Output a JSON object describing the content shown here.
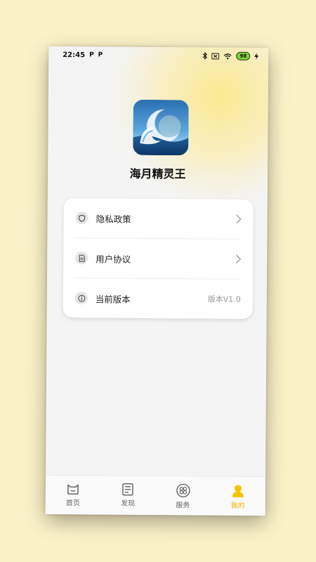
{
  "status_bar": {
    "time": "22:45",
    "notif_icons": [
      "P",
      "P"
    ],
    "battery": "98"
  },
  "app": {
    "name": "海月精灵王"
  },
  "settings": {
    "items": [
      {
        "label": "隐私政策",
        "icon": "shield-icon",
        "right": "chevron"
      },
      {
        "label": "用户协议",
        "icon": "document-icon",
        "right": "chevron"
      },
      {
        "label": "当前版本",
        "icon": "info-icon",
        "value": "版本V1.0"
      }
    ]
  },
  "bottom_nav": {
    "tabs": [
      {
        "label": "首页",
        "icon": "home-icon",
        "active": false
      },
      {
        "label": "发现",
        "icon": "discover-icon",
        "active": false
      },
      {
        "label": "服务",
        "icon": "service-icon",
        "active": false
      },
      {
        "label": "我的",
        "icon": "profile-icon",
        "active": true
      }
    ]
  },
  "colors": {
    "accent": "#e8b400",
    "background": "#fbf3c8",
    "card": "#ffffff"
  }
}
